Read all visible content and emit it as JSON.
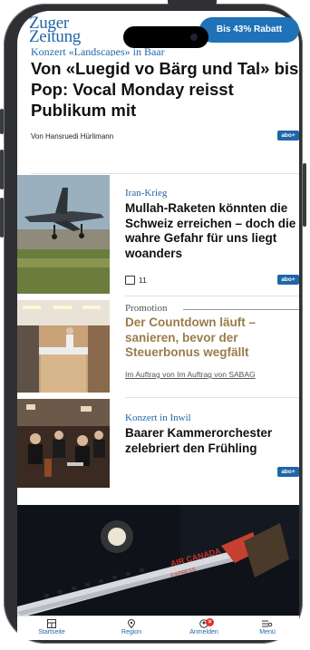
{
  "header": {
    "logo_line1": "Zuger",
    "logo_line2": "Zeitung",
    "promo_button": "Bis 43% Rabatt"
  },
  "hero": {
    "kicker": "Konzert «Landscapes» in Baar",
    "title": "Von «Luegid vo Bärg und Tal» bis Pop: Vocal Monday reisst Publikum mit",
    "byline": "Von Hansruedi Hürlimann",
    "badge": "abo+"
  },
  "articles": [
    {
      "kicker": "Iran-Krieg",
      "title": "Mullah-Raketen könnten die Schweiz erreichen – doch die wahre Gefahr für uns liegt woanders",
      "comments": "11",
      "badge": "abo+"
    },
    {
      "label": "Promotion",
      "title": "Der Countdown läuft – sanieren, bevor der Steuerbonus wegfällt",
      "credit": "Im Auftrag von Im Auftrag von SABAG"
    },
    {
      "kicker": "Konzert in Inwil",
      "title": "Baarer Kammerorchester zelebriert den Frühling",
      "badge": "abo+"
    }
  ],
  "photo": {
    "plane_text": "AIR CANADA",
    "plane_sub": "EXPRESS"
  },
  "tabbar": [
    {
      "label": "Startseite",
      "icon": "home-icon"
    },
    {
      "label": "Region",
      "icon": "location-pin-icon"
    },
    {
      "label": "Anmelden",
      "icon": "user-icon",
      "badge": "×"
    },
    {
      "label": "Menü",
      "icon": "menu-icon"
    }
  ],
  "colors": {
    "brand": "#1f66a8",
    "promo": "#9a7c4a",
    "alert": "#e32b2b"
  }
}
